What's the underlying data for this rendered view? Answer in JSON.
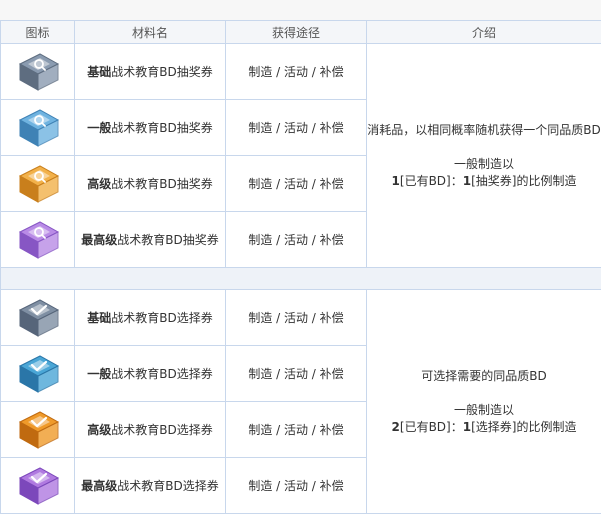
{
  "headers": [
    "图标",
    "材料名",
    "获得途径",
    "介绍"
  ],
  "groups": [
    {
      "items": [
        {
          "prefix": "基础",
          "suffix": "战术教育BD抽奖券",
          "source": "制造 / 活动 / 补偿",
          "icon": "lottery-ticket-icon",
          "color": "#8a9bb0",
          "dark": "#5e6d80"
        },
        {
          "prefix": "一般",
          "suffix": "战术教育BD抽奖券",
          "source": "制造 / 活动 / 补偿",
          "icon": "lottery-ticket-icon",
          "color": "#6fb3e0",
          "dark": "#3f82b5"
        },
        {
          "prefix": "高级",
          "suffix": "战术教育BD抽奖券",
          "source": "制造 / 活动 / 补偿",
          "icon": "lottery-ticket-icon",
          "color": "#f2b14a",
          "dark": "#c97f1c"
        },
        {
          "prefix": "最高级",
          "suffix": "战术教育BD抽奖券",
          "source": "制造 / 活动 / 补偿",
          "icon": "lottery-ticket-icon",
          "color": "#b98be6",
          "dark": "#8756c4"
        }
      ],
      "intro": {
        "line1": "消耗品，以相同概率随机获得一个同品质BD",
        "line2": "一般制造以",
        "ratio_a": "1",
        "ratio_mid": "[已有BD]：",
        "ratio_b": "1",
        "ratio_end": "[抽奖券]的比例制造"
      }
    },
    {
      "items": [
        {
          "prefix": "基础",
          "suffix": "战术教育BD选择券",
          "source": "制造 / 活动 / 补偿",
          "icon": "selection-ticket-icon",
          "color": "#7f8fa3",
          "dark": "#56657a"
        },
        {
          "prefix": "一般",
          "suffix": "战术教育BD选择券",
          "source": "制造 / 活动 / 补偿",
          "icon": "selection-ticket-icon",
          "color": "#4aa6d6",
          "dark": "#2a76a8"
        },
        {
          "prefix": "高级",
          "suffix": "战术教育BD选择券",
          "source": "制造 / 活动 / 补偿",
          "icon": "selection-ticket-icon",
          "color": "#ef9a2a",
          "dark": "#c06a10"
        },
        {
          "prefix": "最高级",
          "suffix": "战术教育BD选择券",
          "source": "制造 / 活动 / 补偿",
          "icon": "selection-ticket-icon",
          "color": "#b07ae0",
          "dark": "#7c48bb"
        }
      ],
      "intro": {
        "line1": "可选择需要的同品质BD",
        "line2": "一般制造以",
        "ratio_a": "2",
        "ratio_mid": "[已有BD]：",
        "ratio_b": "1",
        "ratio_end": "[选择券]的比例制造"
      }
    }
  ]
}
